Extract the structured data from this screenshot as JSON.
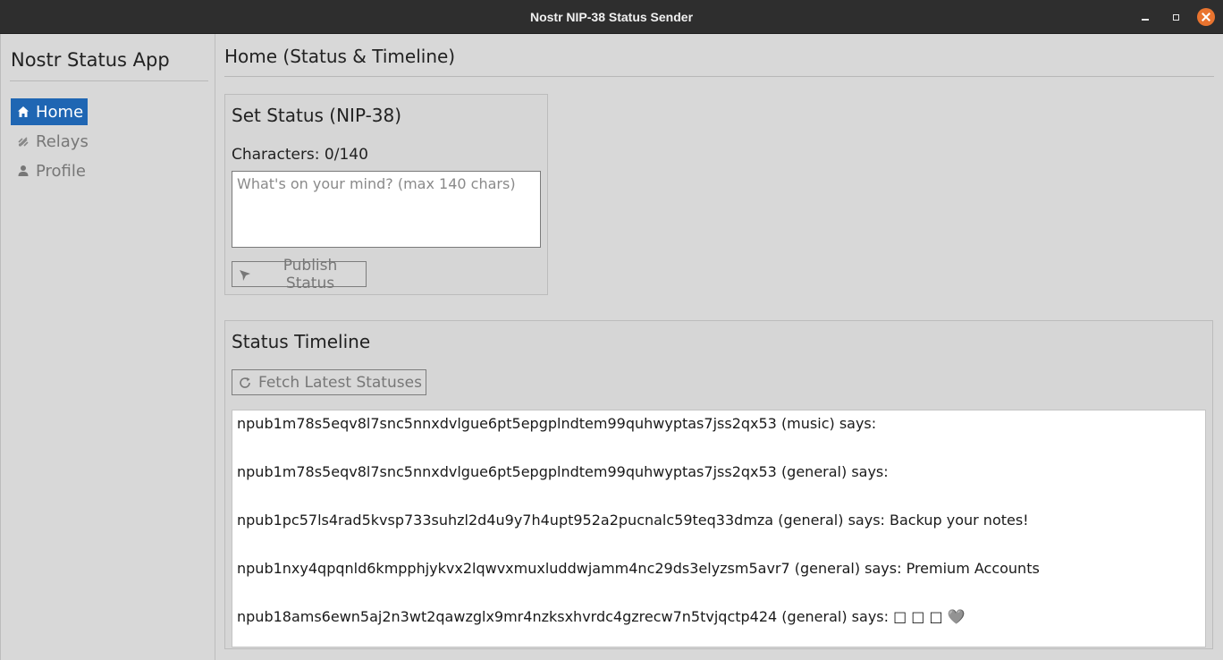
{
  "window": {
    "title": "Nostr NIP-38 Status Sender"
  },
  "sidebar": {
    "app_title": "Nostr Status App",
    "items": [
      {
        "label": "Home",
        "icon": "home-icon",
        "active": true
      },
      {
        "label": "Relays",
        "icon": "relay-icon",
        "active": false
      },
      {
        "label": "Profile",
        "icon": "user-icon",
        "active": false
      }
    ]
  },
  "main": {
    "page_title": "Home (Status & Timeline)",
    "set_status": {
      "title": "Set Status (NIP-38)",
      "char_count": "Characters: 0/140",
      "input_value": "",
      "input_placeholder": "What's on your mind? (max 140 chars)",
      "publish_label": "Publish Status"
    },
    "timeline": {
      "title": "Status Timeline",
      "fetch_label": "Fetch Latest Statuses",
      "items": [
        "npub1m78s5eqv8l7snc5nnxdvlgue6pt5epgplndtem99quhwyptas7jss2qx53 (music) says:",
        "npub1m78s5eqv8l7snc5nnxdvlgue6pt5epgplndtem99quhwyptas7jss2qx53 (general) says:",
        "npub1pc57ls4rad5kvsp733suhzl2d4u9y7h4upt952a2pucnalc59teq33dmza (general) says: Backup your notes!",
        "npub1nxy4qpqnld6kmpphjykvx2lqwvxmuxluddwjamm4nc29ds3elyzsm5avr7 (general) says: Premium Accounts",
        "npub18ams6ewn5aj2n3wt2qawzglx9mr4nzksxhvrdc4gzrecw7n5tvjqctp424 (general) says: □ □ □ 🩶"
      ]
    }
  },
  "colors": {
    "accent": "#1f66b3",
    "close_button": "#e9742f",
    "titlebar": "#2e2e2e",
    "background": "#d8d8d8"
  }
}
